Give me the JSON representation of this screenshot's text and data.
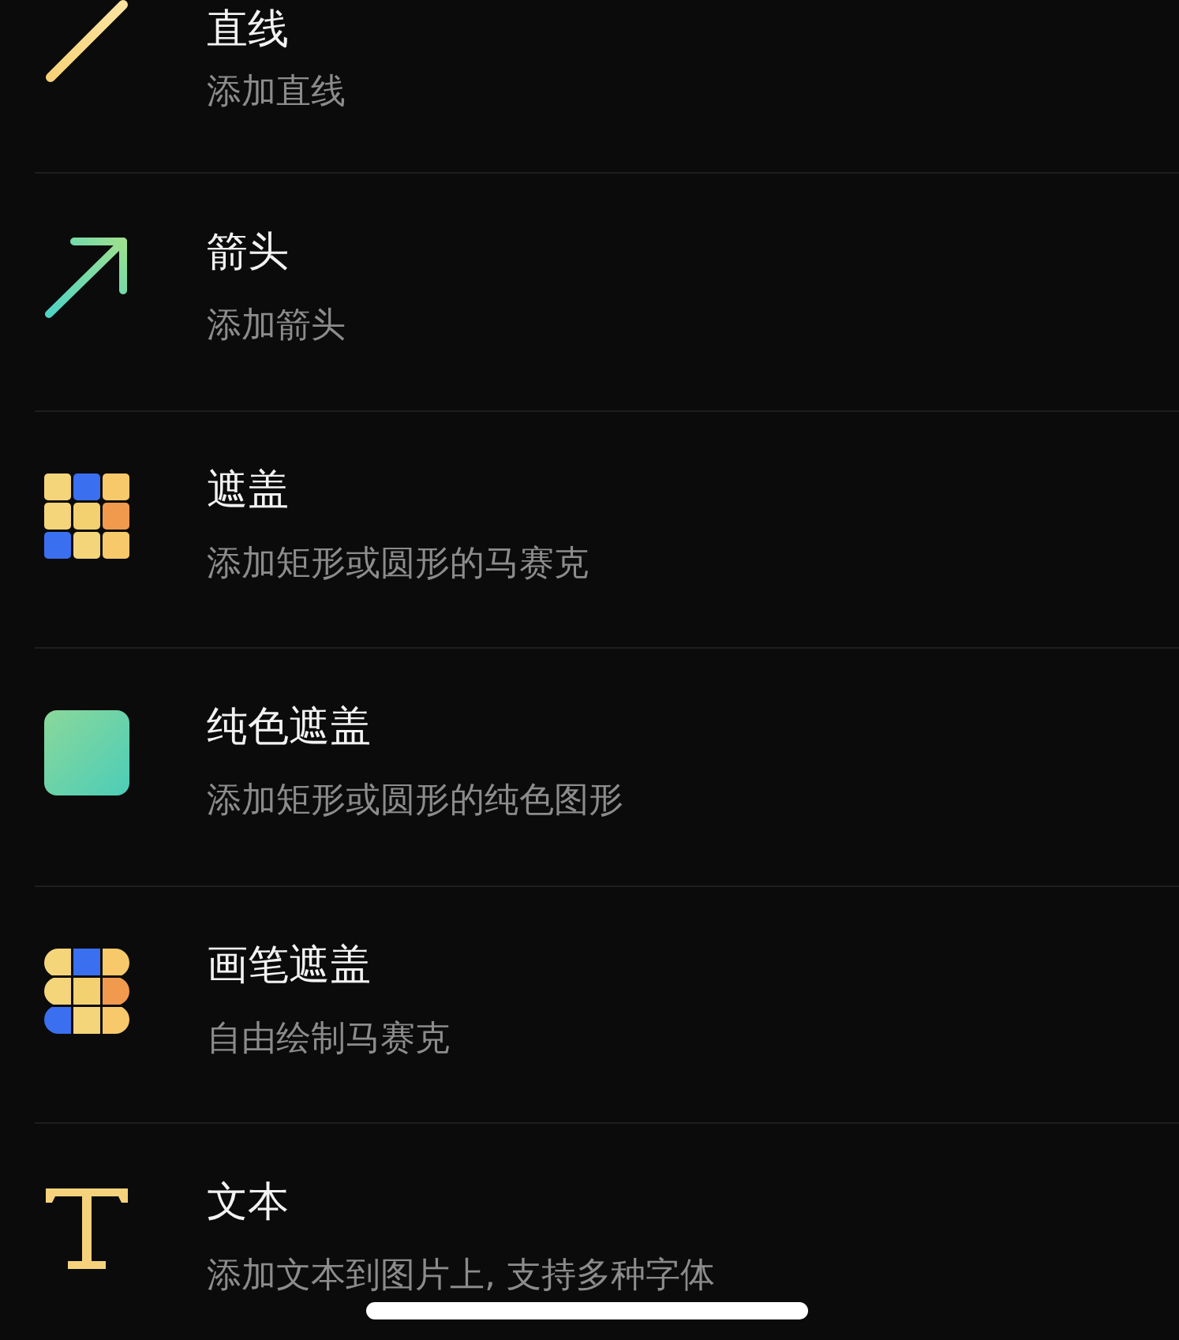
{
  "tools": [
    {
      "kind": "line",
      "title": "直线",
      "subtitle": "添加直线"
    },
    {
      "kind": "arrow",
      "title": "箭头",
      "subtitle": "添加箭头"
    },
    {
      "kind": "mosaic",
      "title": "遮盖",
      "subtitle": "添加矩形或圆形的马赛克"
    },
    {
      "kind": "solid",
      "title": "纯色遮盖",
      "subtitle": "添加矩形或圆形的纯色图形"
    },
    {
      "kind": "brush",
      "title": "画笔遮盖",
      "subtitle": "自由绘制马赛克"
    },
    {
      "kind": "text",
      "title": "文本",
      "subtitle": "添加文本到图片上, 支持多种字体"
    }
  ]
}
